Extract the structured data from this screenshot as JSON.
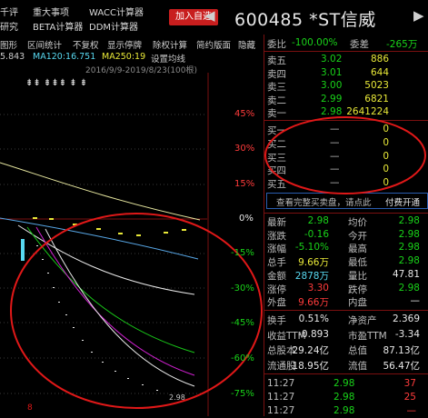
{
  "top_menu": {
    "row1": [
      "千评",
      "重大事项",
      "WACC计算器"
    ],
    "row2": [
      "研究",
      "BETA计算器",
      "DDM计算器"
    ],
    "add_button": "加入自选",
    "prev": "◀",
    "next": "▶"
  },
  "stock": {
    "code": "600485",
    "name": "*ST信威"
  },
  "toolbar": [
    "图形",
    "区间统计",
    "不复权",
    "显示停牌",
    "除权计算",
    "简约版面",
    "隐藏"
  ],
  "ma_row": [
    {
      "text": "5.843",
      "color": "#c8c8c8"
    },
    {
      "text": "MA120:16.751",
      "color": "#58d8f0"
    },
    {
      "text": "MA250:19",
      "color": "#e8e838"
    },
    {
      "text": "设置均线",
      "color": "#c8c8c8"
    }
  ],
  "range_label": "2016/9/9-2019/8/23(100根)",
  "y_axis": [
    "45%",
    "30%",
    "15%",
    "0%",
    "-15%",
    "-30%",
    "-45%",
    "-60%",
    "-75%"
  ],
  "corner_value": "2.98",
  "markers": "⇟⇟  ⇟⇟⇟ ⇟ ⇟",
  "right_panel": {
    "weibi": {
      "label": "委比",
      "value": "-100.00%",
      "diff_label": "委差",
      "diff": "-265万"
    },
    "asks": [
      {
        "label": "卖五",
        "price": "3.02",
        "vol": "886"
      },
      {
        "label": "卖四",
        "price": "3.01",
        "vol": "644"
      },
      {
        "label": "卖三",
        "price": "3.00",
        "vol": "5023"
      },
      {
        "label": "卖二",
        "price": "2.99",
        "vol": "6821"
      },
      {
        "label": "卖一",
        "price": "2.98",
        "vol": "2641224"
      }
    ],
    "bids": [
      {
        "label": "买一",
        "price": "—",
        "vol": "0"
      },
      {
        "label": "买二",
        "price": "—",
        "vol": "0"
      },
      {
        "label": "买三",
        "price": "—",
        "vol": "0"
      },
      {
        "label": "买四",
        "price": "—",
        "vol": "0"
      },
      {
        "label": "买五",
        "price": "—",
        "vol": "0"
      }
    ],
    "full_link": "查看完整买卖盘，请点此",
    "pay_link": "付费开通",
    "stats": [
      {
        "l1": "最新",
        "v1": "2.98",
        "c1": "green",
        "l2": "均价",
        "v2": "2.98",
        "c2": "green"
      },
      {
        "l1": "涨跌",
        "v1": "-0.16",
        "c1": "green",
        "l2": "今开",
        "v2": "2.98",
        "c2": "green"
      },
      {
        "l1": "涨幅",
        "v1": "-5.10%",
        "c1": "green",
        "l2": "最高",
        "v2": "2.98",
        "c2": "green"
      },
      {
        "l1": "总手",
        "v1": "9.66万",
        "c1": "yellow",
        "l2": "最低",
        "v2": "2.98",
        "c2": "green"
      },
      {
        "l1": "金额",
        "v1": "2878万",
        "c1": "cyan",
        "l2": "量比",
        "v2": "47.81",
        "c2": "white"
      },
      {
        "l1": "涨停",
        "v1": "3.30",
        "c1": "red",
        "l2": "跌停",
        "v2": "2.98",
        "c2": "green"
      },
      {
        "l1": "外盘",
        "v1": "9.66万",
        "c1": "red",
        "l2": "内盘",
        "v2": "—",
        "c2": "white"
      }
    ],
    "fin": [
      {
        "l1": "换手",
        "v1": "0.51%",
        "l2": "净资产",
        "v2": "2.369"
      },
      {
        "l1": "收益TTM",
        "v1": "-0.893",
        "l2": "市盈TTM",
        "v2": "-3.34"
      },
      {
        "l1": "总股本",
        "v1": "29.24亿",
        "l2": "总值",
        "v2": "87.13亿"
      },
      {
        "l1": "流通股",
        "v1": "18.95亿",
        "l2": "流值",
        "v2": "56.47亿"
      }
    ],
    "ticks": [
      {
        "time": "11:27",
        "price": "2.98",
        "vol": "37"
      },
      {
        "time": "11:27",
        "price": "2.98",
        "vol": "25"
      },
      {
        "time": "11:27",
        "price": "2.98",
        "vol": "—"
      }
    ]
  }
}
